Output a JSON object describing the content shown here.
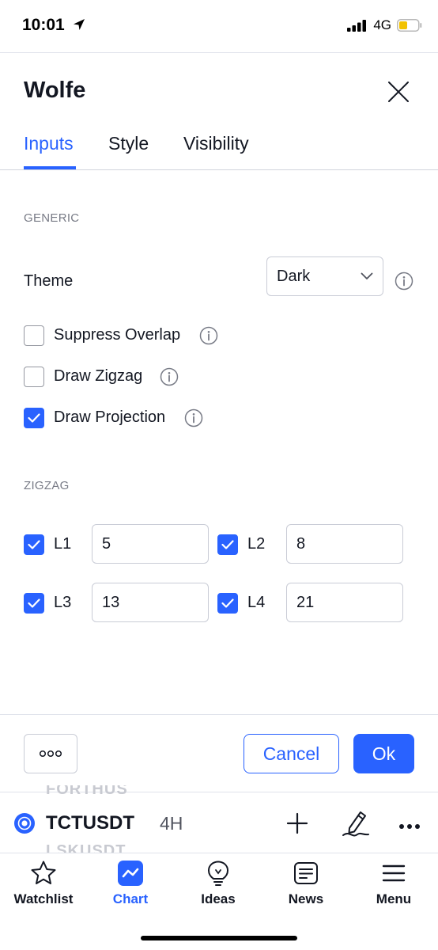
{
  "status": {
    "time": "10:01",
    "network": "4G"
  },
  "dialog": {
    "title": "Wolfe",
    "tabs": [
      {
        "label": "Inputs",
        "active": true
      },
      {
        "label": "Style",
        "active": false
      },
      {
        "label": "Visibility",
        "active": false
      }
    ],
    "generic": {
      "section_label": "GENERIC",
      "theme_label": "Theme",
      "theme_value": "Dark",
      "options": [
        {
          "label": "Suppress Overlap",
          "checked": false
        },
        {
          "label": "Draw Zigzag",
          "checked": false
        },
        {
          "label": "Draw Projection",
          "checked": true
        }
      ]
    },
    "zigzag": {
      "section_label": "ZIGZAG",
      "levels": [
        {
          "label": "L1",
          "value": "5",
          "checked": true
        },
        {
          "label": "L2",
          "value": "8",
          "checked": true
        },
        {
          "label": "L3",
          "value": "13",
          "checked": true
        },
        {
          "label": "L4",
          "value": "21",
          "checked": true
        }
      ]
    },
    "footer": {
      "cancel_label": "Cancel",
      "ok_label": "Ok"
    }
  },
  "chart_bar": {
    "ghost_above": "FORTHUS",
    "ghost_below": "LSKUSDT",
    "symbol": "TCTUSDT",
    "interval": "4H"
  },
  "bottom_nav": {
    "items": [
      {
        "label": "Watchlist",
        "icon": "star-icon",
        "active": false
      },
      {
        "label": "Chart",
        "icon": "chart-icon",
        "active": true
      },
      {
        "label": "Ideas",
        "icon": "lightbulb-icon",
        "active": false
      },
      {
        "label": "News",
        "icon": "newspaper-icon",
        "active": false
      },
      {
        "label": "Menu",
        "icon": "hamburger-icon",
        "active": false
      }
    ]
  },
  "colors": {
    "accent": "#2962ff",
    "text": "#131722",
    "muted": "#787b86",
    "border": "#c9ccd6"
  }
}
